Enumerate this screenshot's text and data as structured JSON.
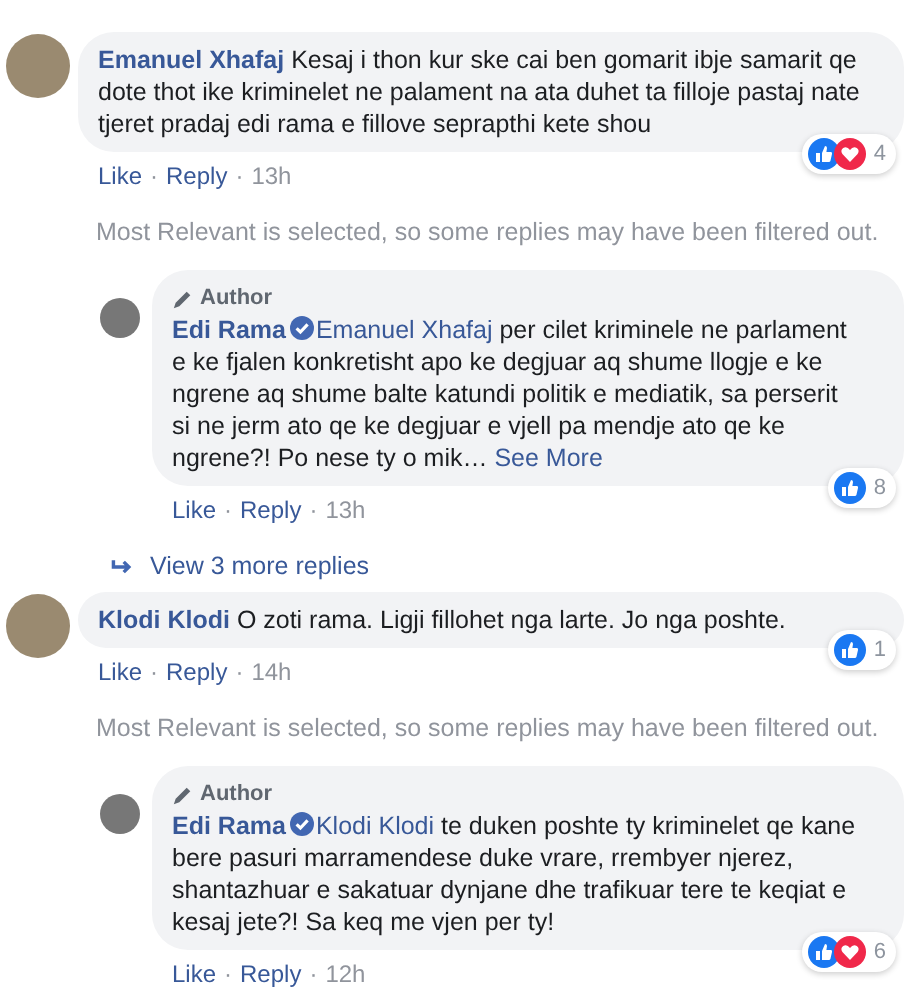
{
  "items": [
    {
      "kind": "comment",
      "reply": false,
      "name": "Emanuel Xhafaj",
      "verified": false,
      "text": "Kesaj i thon kur ske cai ben gomarit ibje samarit qe dote thot ike kriminelet ne palament na ata duhet ta filloje pastaj nate tjeret pradaj edi rama e fillove seprapthi kete shou",
      "reactions": [
        {
          "kind": "like"
        },
        {
          "kind": "love"
        }
      ],
      "reaction_count": "4",
      "actions": [
        "Like",
        "Reply"
      ],
      "separator": "·",
      "time": "13h"
    },
    {
      "kind": "note",
      "text": "Most Relevant is selected, so some replies may have been filtered out."
    },
    {
      "kind": "comment",
      "reply": true,
      "author_badge": "Author",
      "name": "Edi Rama",
      "verified": true,
      "mention": "Emanuel Xhafaj",
      "text": "per cilet kriminele ne parlament e ke fjalen konkretisht apo ke degjuar aq shume llogje e ke ngrene aq shume balte katundi politik e mediatik, sa perserit si ne jerm ato qe ke degjuar e vjell pa mendje ato qe ke ngrene?! Po nese ty o mik…",
      "see_more": "See More",
      "reactions": [
        {
          "kind": "like"
        }
      ],
      "reaction_count": "8",
      "actions": [
        "Like",
        "Reply"
      ],
      "separator": "·",
      "time": "13h"
    },
    {
      "kind": "view_more",
      "text": "View 3 more replies"
    },
    {
      "kind": "comment",
      "reply": false,
      "name": "Klodi Klodi",
      "verified": false,
      "text": "O zoti rama. Ligji fillohet nga larte. Jo nga poshte.",
      "reactions": [
        {
          "kind": "like"
        }
      ],
      "reaction_count": "1",
      "actions": [
        "Like",
        "Reply"
      ],
      "separator": "·",
      "time": "14h"
    },
    {
      "kind": "note",
      "text": "Most Relevant is selected, so some replies may have been filtered out."
    },
    {
      "kind": "comment",
      "reply": true,
      "author_badge": "Author",
      "name": "Edi Rama",
      "verified": true,
      "mention": "Klodi Klodi",
      "text": "te duken poshte ty kriminelet qe kane bere pasuri marramendese duke vrare, rrembyer njerez, shantazhuar e sakatuar dynjane dhe trafikuar tere te keqiat e kesaj jete?! Sa keq me vjen per ty!",
      "reactions": [
        {
          "kind": "like"
        },
        {
          "kind": "love"
        }
      ],
      "reaction_count": "6",
      "actions": [
        "Like",
        "Reply"
      ],
      "separator": "·",
      "time": "12h"
    }
  ]
}
